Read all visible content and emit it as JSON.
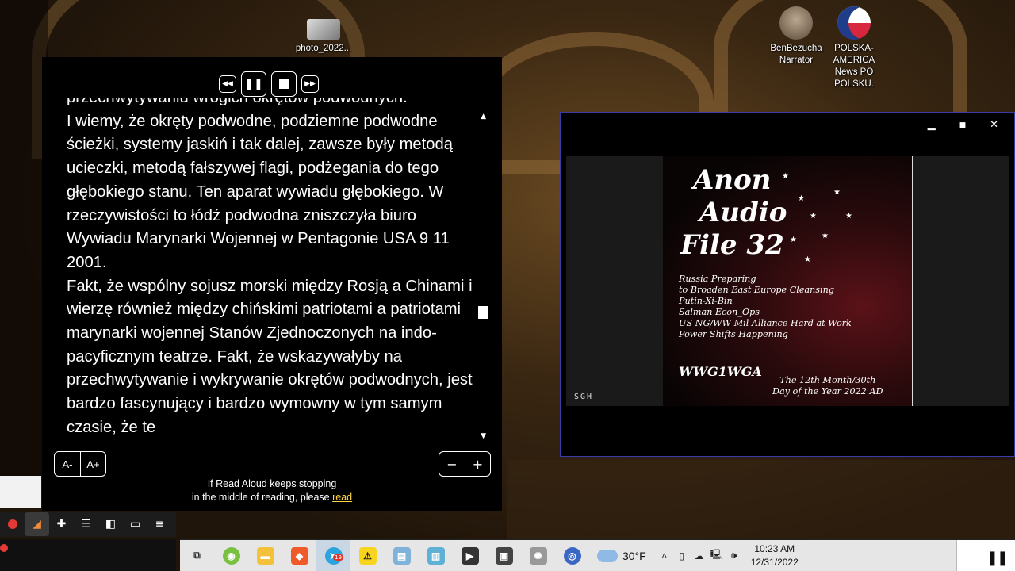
{
  "desktop": {
    "icons": [
      {
        "label": "photo_2022..."
      },
      {
        "label": "BenBezucha Narrator"
      },
      {
        "label": "POLSKA-AMERICA News PO POLSKU."
      }
    ]
  },
  "reader": {
    "controls": {
      "rewind_icon": "rewind-icon",
      "pause_icon": "pause-icon",
      "stop_icon": "stop-icon",
      "forward_icon": "fast-forward-icon"
    },
    "paragraphs": [
      "przechwytywaniu wrogich okrętów podwodnych.",
      "I wiemy, że okręty podwodne, podziemne podwodne ścieżki, systemy jaskiń i tak dalej, zawsze były metodą ucieczki, metodą fałszywej flagi, podżegania do tego głębokiego stanu. Ten aparat wywiadu głębokiego. W rzeczywistości to łódź podwodna zniszczyła biuro Wywiadu Marynarki Wojennej w Pentagonie USA 9 11 2001.",
      "Fakt, że wspólny sojusz morski między Rosją a Chinami i wierzę również między chińskimi patriotami a patriotami marynarki wojennej Stanów Zjednoczonych na indo-pacyficznym teatrze. Fakt, że wskazywałyby na przechwytywanie i wykrywanie okrętów podwodnych, jest bardzo fascynujący i bardzo wymowny w tym samym czasie, że te"
    ],
    "font_decrease": "A-",
    "font_increase": "A+",
    "speed_decrease": "−",
    "speed_increase": "+",
    "notice_line1": "If Read Aloud keeps stopping",
    "notice_line2": "in the middle of reading, please",
    "notice_link": "read"
  },
  "video": {
    "window_controls": {
      "minimize": "▁",
      "maximize": "■",
      "close": "✕"
    },
    "poster_title": [
      "Anon",
      "Audio",
      "File 32"
    ],
    "poster_lines": [
      "Russia Preparing",
      "to Broaden East Europe Cleansing",
      "Putin-Xi-Bin",
      "Salman Econ_Ops",
      "US NG/WW Mil Alliance Hard at Work",
      "Power Shifts Happening"
    ],
    "poster_code": "WWG1WGA",
    "poster_date": [
      "The 12th Month/30th",
      "Day of the Year 2022 AD"
    ],
    "tag": "SGH"
  },
  "taskbar": {
    "weather": "30°F",
    "time": "10:23 AM",
    "date": "12/31/2022",
    "telegram_badge": "19",
    "apps": [
      {
        "name": "task-view-icon",
        "glyph": "⧉",
        "color": "#e6e6e6",
        "fg": "#333"
      },
      {
        "name": "android-app-icon",
        "glyph": "◉",
        "color": "#7ac142",
        "fg": "#fff"
      },
      {
        "name": "file-explorer-icon",
        "glyph": "▬",
        "color": "#f3c13a",
        "fg": "#fff"
      },
      {
        "name": "brave-browser-icon",
        "glyph": "◆",
        "color": "#f05a28",
        "fg": "#fff"
      },
      {
        "name": "telegram-icon",
        "glyph": "➤",
        "color": "#2aa3de",
        "fg": "#fff"
      },
      {
        "name": "sticky-app-icon",
        "glyph": "⚠",
        "color": "#f7d41e",
        "fg": "#222"
      },
      {
        "name": "document-app-icon",
        "glyph": "▤",
        "color": "#7fb3d9",
        "fg": "#fff"
      },
      {
        "name": "notes-app-icon",
        "glyph": "▥",
        "color": "#5fb0d5",
        "fg": "#fff"
      },
      {
        "name": "video-editor-icon",
        "glyph": "▶",
        "color": "#333333",
        "fg": "#fff"
      },
      {
        "name": "photos-icon",
        "glyph": "▣",
        "color": "#444444",
        "fg": "#fff"
      },
      {
        "name": "network-tool-icon",
        "glyph": "✺",
        "color": "#999999",
        "fg": "#fff"
      },
      {
        "name": "obs-icon",
        "glyph": "◎",
        "color": "#3a66c4",
        "fg": "#fff"
      }
    ]
  },
  "extensions_bar": {
    "items": [
      "record-icon",
      "read-aloud-icon",
      "puzzle-icon",
      "playlist-icon",
      "sidebar-icon",
      "wallet-icon",
      "menu-icon"
    ]
  }
}
